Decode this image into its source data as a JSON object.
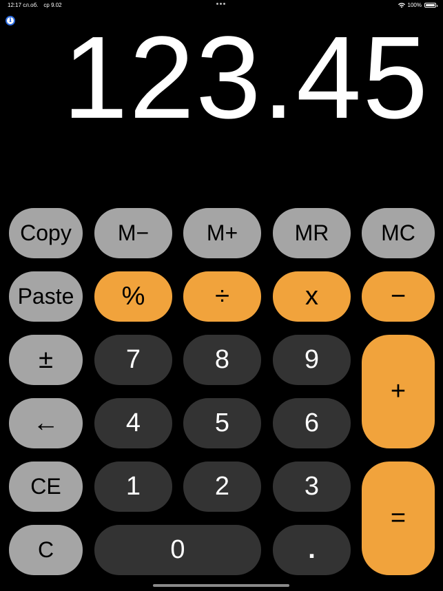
{
  "status": {
    "time": "12:17 сл.об.",
    "date": "ср 9.02",
    "battery": "100%",
    "wifi_icon": "wifi-icon",
    "battery_icon": "battery-icon"
  },
  "info_icon": "i",
  "display": {
    "value": "123.45"
  },
  "colors": {
    "gray": "#a5a5a5",
    "orange": "#f1a33c",
    "dark": "#333333",
    "background": "#000000"
  },
  "keys": {
    "copy": "Copy",
    "m_minus": "M−",
    "m_plus": "M+",
    "mr": "MR",
    "mc": "MC",
    "paste": "Paste",
    "percent": "%",
    "divide": "÷",
    "multiply": "x",
    "minus": "−",
    "plus_minus": "±",
    "seven": "7",
    "eight": "8",
    "nine": "9",
    "plus": "+",
    "backspace": "←",
    "four": "4",
    "five": "5",
    "six": "6",
    "ce": "CE",
    "one": "1",
    "two": "2",
    "three": "3",
    "equals": "=",
    "clear": "C",
    "zero": "0",
    "decimal": "."
  }
}
